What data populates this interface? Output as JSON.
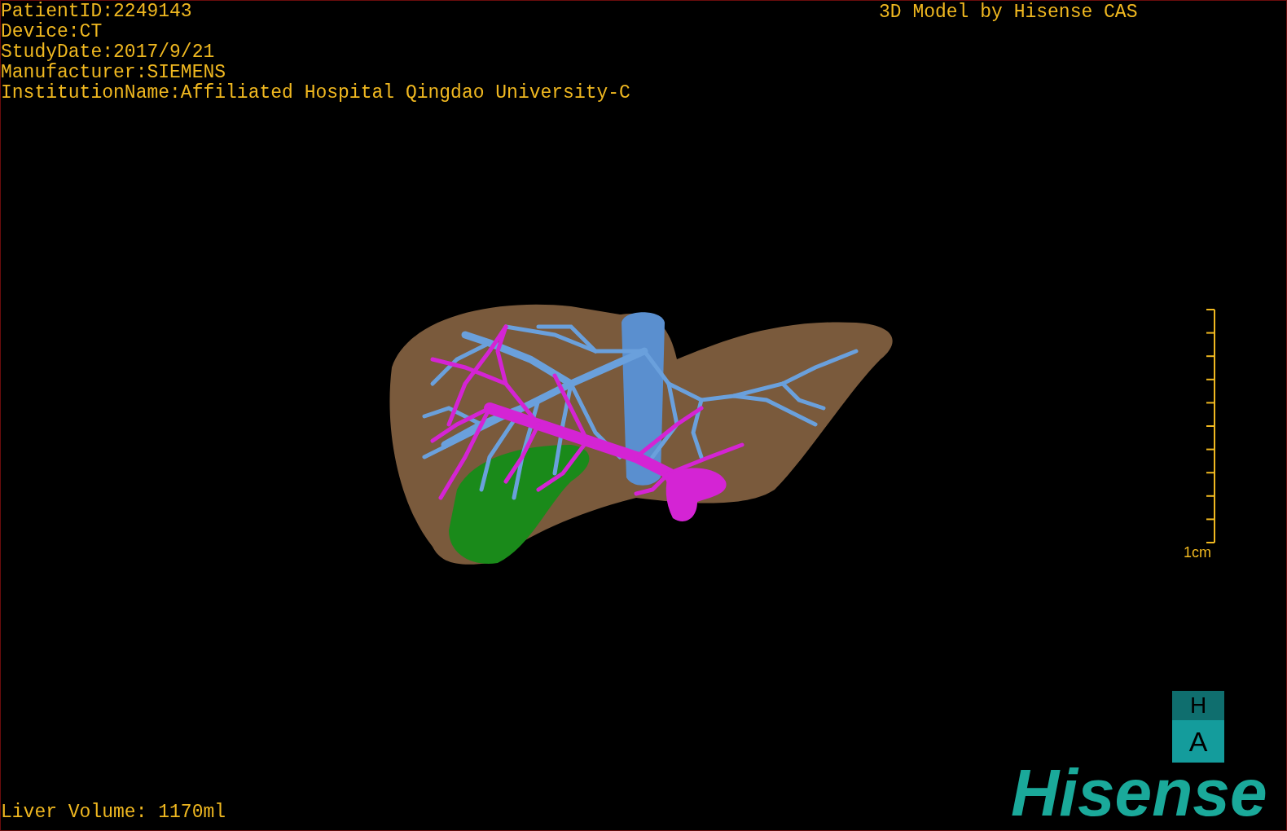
{
  "patient_info": [
    "PatientID:2249143",
    "Device:CT",
    "StudyDate:2017/9/21",
    "Manufacturer:SIEMENS",
    "InstitutionName:Affiliated Hospital Qingdao University-C"
  ],
  "model_credit": "3D Model by Hisense CAS",
  "scale_bar": {
    "label": "1cm"
  },
  "orientation_cube": {
    "top_face": "H",
    "front_face": "A"
  },
  "logo": "Hisense",
  "liver_volume": "Liver Volume: 1170ml"
}
